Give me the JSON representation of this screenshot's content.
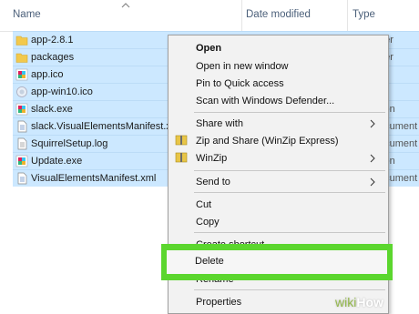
{
  "header": {
    "name_label": "Name",
    "date_label": "Date modified",
    "type_label": "Type"
  },
  "files": [
    {
      "name": "app-2.8.1",
      "icon": "folder-icon",
      "type": "File folder",
      "type_visible": "der"
    },
    {
      "name": "packages",
      "icon": "folder-icon",
      "type": "File folder",
      "type_visible": "der"
    },
    {
      "name": "app.ico",
      "icon": "slack-app-icon",
      "type": "",
      "type_visible": ""
    },
    {
      "name": "app-win10.ico",
      "icon": "ico-file-icon",
      "type": "",
      "type_visible": ""
    },
    {
      "name": "slack.exe",
      "icon": "slack-app-icon",
      "type": "Application",
      "type_visible": "tion"
    },
    {
      "name": "slack.VisualElementsManifest.xml",
      "icon": "xml-file-icon",
      "type": "XML Document",
      "type_visible": "ocument"
    },
    {
      "name": "SquirrelSetup.log",
      "icon": "text-file-icon",
      "type": "Text Document",
      "type_visible": "ocument"
    },
    {
      "name": "Update.exe",
      "icon": "update-exe-icon",
      "type": "Application",
      "type_visible": "tion"
    },
    {
      "name": "VisualElementsManifest.xml",
      "icon": "xml-file-icon",
      "type": "XML Document",
      "type_visible": "ocument"
    }
  ],
  "context_menu": {
    "open": "Open",
    "open_new_window": "Open in new window",
    "pin_quick_access": "Pin to Quick access",
    "scan_defender": "Scan with Windows Defender...",
    "share_with": "Share with",
    "zip_share": "Zip and Share (WinZip Express)",
    "winzip": "WinZip",
    "send_to": "Send to",
    "cut": "Cut",
    "copy": "Copy",
    "create_shortcut": "Create shortcut",
    "delete": "Delete",
    "rename": "Rename",
    "properties": "Properties"
  },
  "highlight_color": "#5bd62e",
  "watermark": {
    "wiki": "wiki",
    "how": "How"
  }
}
